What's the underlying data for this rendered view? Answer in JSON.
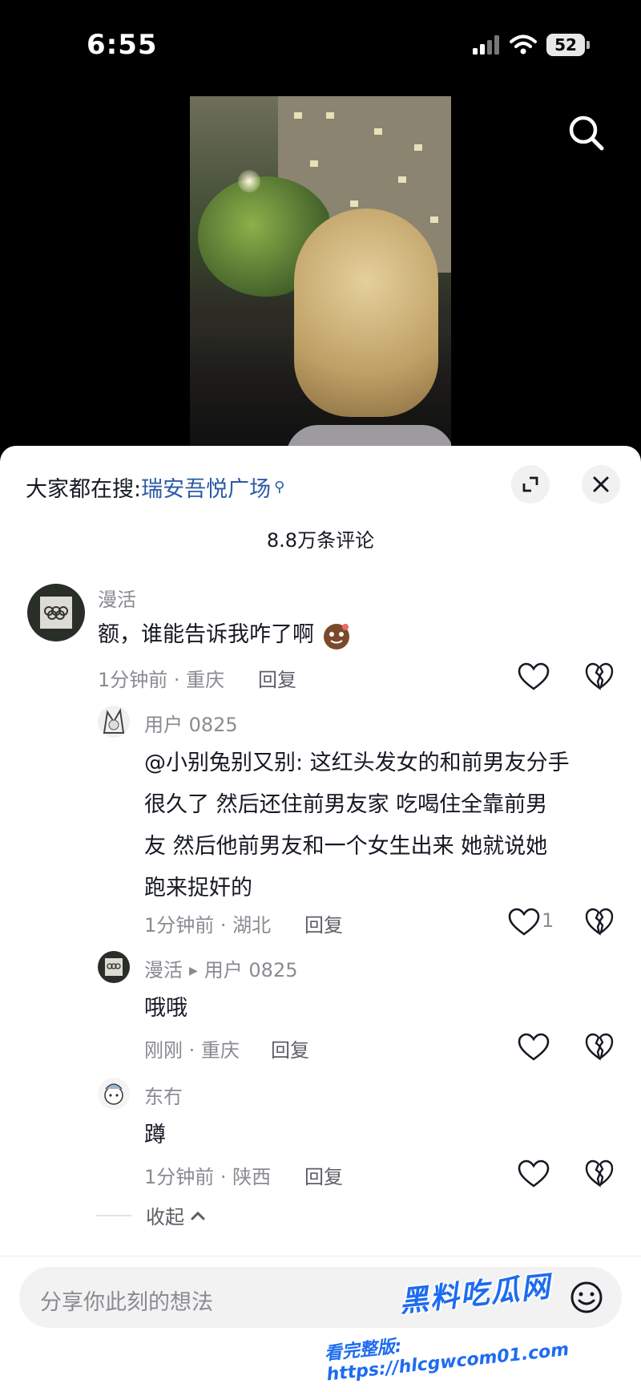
{
  "status_bar": {
    "time": "6:55",
    "battery": "52"
  },
  "comments_sheet": {
    "suggest_prefix": "大家都在搜:",
    "suggest_keyword": "瑞安吾悦广场",
    "comment_count": "8.8万条评论",
    "reply_label": "回复",
    "comments": [
      {
        "user": "漫活",
        "text": "额，谁能告诉我咋了啊",
        "time_location": "1分钟前 · 重庆",
        "likes": ""
      },
      {
        "user": "用户 0825",
        "text_lines": [
          "@小别兔别又别: 这红头发女的和前男友分手",
          "很久了  然后还住前男友家  吃喝住全靠前男",
          "友  然后他前男友和一个女生出来  她就说她",
          "跑来捉奸的"
        ],
        "time_location": "1分钟前 · 湖北",
        "likes": "1"
      },
      {
        "user": "漫活",
        "reply_to": "用户 0825",
        "text": "哦哦",
        "time_location": "刚刚 · 重庆",
        "likes": ""
      },
      {
        "user": "东冇",
        "text": "蹲",
        "time_location": "1分钟前 · 陕西",
        "likes": ""
      }
    ],
    "collapse_label": "收起",
    "input_placeholder": "分享你此刻的想法"
  },
  "watermark": {
    "title": "黑料吃瓜网",
    "url": "看完整版: https://hlcgwcom01.com"
  },
  "icons": {
    "search": "search-icon",
    "expand": "expand-icon",
    "close": "close-icon",
    "like": "heart-icon",
    "dislike": "broken-heart-icon",
    "emoji": "smiley-icon"
  }
}
